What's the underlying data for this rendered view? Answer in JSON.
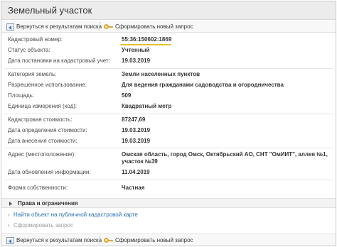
{
  "window": {
    "title": "Земельный участок"
  },
  "toolbar": {
    "back_label": "Вернуться к результатам поиска",
    "new_request_label": "Сформировать новый запрос"
  },
  "fields": {
    "cadastral_number": {
      "label": "Кадастровый номер:",
      "value": "55:36:150602:1869"
    },
    "status": {
      "label": "Статус объекта:",
      "value": "Учтенный"
    },
    "registration_date": {
      "label": "Дата постановки на кадастровый учет:",
      "value": "19.03.2019"
    },
    "land_category": {
      "label": "Категория земель:",
      "value": "Земли населенных пунктов"
    },
    "permitted_use": {
      "label": "Разрешенное использование:",
      "value": "Для ведения гражданами садоводства и огородничества"
    },
    "area": {
      "label": "Площадь:",
      "value": "509"
    },
    "unit": {
      "label": "Единица измерения (код):",
      "value": "Квадратный метр"
    },
    "cadastral_value": {
      "label": "Кадастровая стоимость:",
      "value": "87247,69"
    },
    "value_determination_date": {
      "label": "Дата определения стоимости:",
      "value": "19.03.2019"
    },
    "value_entry_date": {
      "label": "Дата внесения стоимости:",
      "value": "19.03.2019"
    },
    "address": {
      "label": "Адрес (местоположение):",
      "value": "Омская область, город Омск, Октябрьский АО, СНТ \"ОмИИТ\", аллея №1, участок №39"
    },
    "info_update_date": {
      "label": "Дата обновления информации:",
      "value": "11.04.2019"
    },
    "ownership_form": {
      "label": "Форма собственности:",
      "value": "Частная"
    }
  },
  "sections": {
    "rights_label": "Права и ограничения"
  },
  "links": {
    "find_on_map": "Найти объект на публичной кадастровой карте",
    "form_request": "Сформировать запрос"
  },
  "colors": {
    "title_bar": "#ececec",
    "link": "#2a6fb0",
    "highlight_underline": "#e7c22a"
  },
  "icons": {
    "back": "back-arrow-icon",
    "new_request": "key-icon",
    "rights_toggle": "triangle-right-icon",
    "bullet": "chevron-right-icon"
  }
}
